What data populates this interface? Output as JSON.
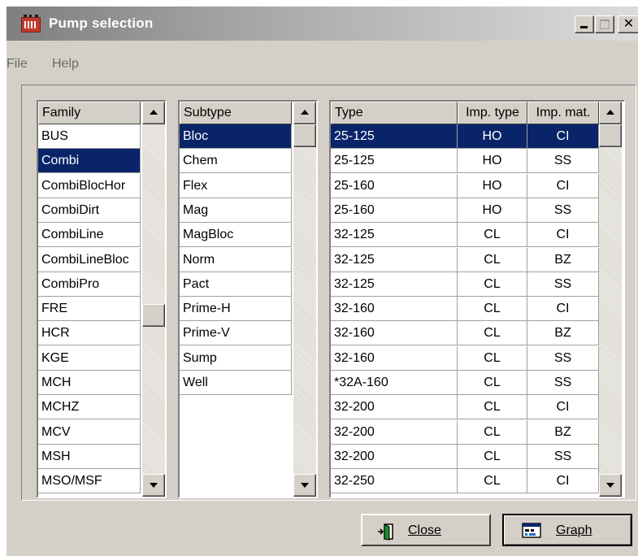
{
  "window": {
    "title": "Pump selection"
  },
  "menu": {
    "file": "File",
    "help": "Help"
  },
  "family": {
    "header": "Family",
    "items": [
      "BUS",
      "Combi",
      "CombiBlocHor",
      "CombiDirt",
      "CombiLine",
      "CombiLineBloc",
      "CombiPro",
      "FRE",
      "HCR",
      "KGE",
      "MCH",
      "MCHZ",
      "MCV",
      "MSH",
      "MSO/MSF"
    ],
    "selected_index": 1,
    "scroll_fraction": 0.55
  },
  "subtype": {
    "header": "Subtype",
    "items": [
      "Bloc",
      "Chem",
      "Flex",
      "Mag",
      "MagBloc",
      "Norm",
      "Pact",
      "Prime-H",
      "Prime-V",
      "Sump",
      "Well"
    ],
    "selected_index": 0,
    "scroll_fraction": 0.0
  },
  "types": {
    "columns": [
      "Type",
      "Imp. type",
      "Imp. mat."
    ],
    "rows": [
      [
        "25-125",
        "HO",
        "CI"
      ],
      [
        "25-125",
        "HO",
        "SS"
      ],
      [
        "25-160",
        "HO",
        "CI"
      ],
      [
        "25-160",
        "HO",
        "SS"
      ],
      [
        "32-125",
        "CL",
        "CI"
      ],
      [
        "32-125",
        "CL",
        "BZ"
      ],
      [
        "32-125",
        "CL",
        "SS"
      ],
      [
        "32-160",
        "CL",
        "CI"
      ],
      [
        "32-160",
        "CL",
        "BZ"
      ],
      [
        "32-160",
        "CL",
        "SS"
      ],
      [
        "*32A-160",
        "CL",
        "SS"
      ],
      [
        "32-200",
        "CL",
        "CI"
      ],
      [
        "32-200",
        "CL",
        "BZ"
      ],
      [
        "32-200",
        "CL",
        "SS"
      ],
      [
        "32-250",
        "CL",
        "CI"
      ]
    ],
    "selected_index": 0,
    "scroll_fraction": 0.0
  },
  "buttons": {
    "close": "Close",
    "graph": "Graph"
  },
  "colors": {
    "selection": "#0a246a",
    "face": "#d4d0c8"
  }
}
